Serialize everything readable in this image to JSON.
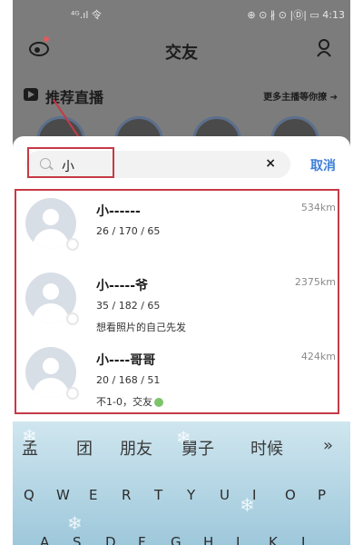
{
  "status_bar": {
    "left": "⁴ᴳ.ıl 令",
    "right": "⊕ ⊙ ∦ ⊙ |Ⓓ| ▭ 4:13"
  },
  "header": {
    "title": "交友"
  },
  "live_section": {
    "label": "推荐直播",
    "more": "更多主播等你撩 ➔"
  },
  "search": {
    "query": "小",
    "clear": "×",
    "cancel": "取消"
  },
  "results": [
    {
      "name": "小------",
      "stats": "26 / 170 / 65",
      "note": "",
      "distance": "534km"
    },
    {
      "name": "小-----爷",
      "stats": "35 / 182 / 65",
      "note": "想看照片的自己先发",
      "distance": "2375km"
    },
    {
      "name": "小----哥哥",
      "stats": "20 / 168 / 51",
      "note": "不1-0，交友",
      "distance": "424km"
    }
  ],
  "keyboard": {
    "candidates": [
      "孟",
      "团",
      "朋友",
      "舅子",
      "时候",
      "»"
    ],
    "row1": [
      "Q",
      "W",
      "E",
      "R",
      "T",
      "Y",
      "U",
      "I",
      "O",
      "P"
    ],
    "row2": [
      "A",
      "S",
      "D",
      "F",
      "G",
      "H",
      "J",
      "K",
      "L"
    ]
  }
}
